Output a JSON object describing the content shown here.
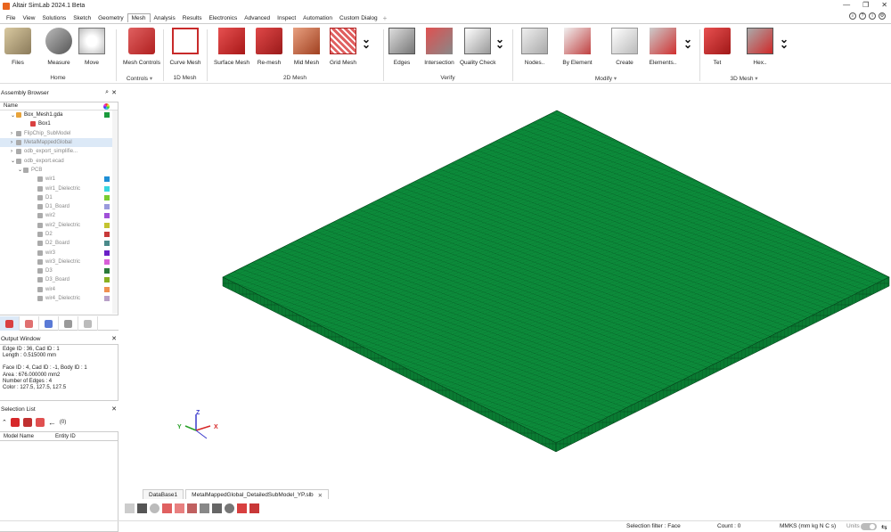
{
  "app": {
    "title": "Altair SimLab 2024.1 Beta"
  },
  "window_controls": {
    "minimize": "—",
    "restore": "❐",
    "close": "✕"
  },
  "menu": [
    "File",
    "View",
    "Solutions",
    "Sketch",
    "Geometry",
    "Mesh",
    "Analysis",
    "Results",
    "Electronics",
    "Advanced",
    "Inspect",
    "Automation",
    "Custom Dialog"
  ],
  "menu_active": "Mesh",
  "menu_right_icons": [
    "search-icon",
    "help-icon",
    "info-icon",
    "settings-icon"
  ],
  "ribbon": {
    "tools": [
      {
        "label": "Files",
        "icon": "files-icon"
      },
      {
        "label": "Measure",
        "icon": "measure-icon"
      },
      {
        "label": "Move",
        "icon": "move-icon"
      },
      {
        "label": "Mesh Controls",
        "icon": "mesh-controls-icon"
      },
      {
        "label": "Curve Mesh",
        "icon": "curve-mesh-icon"
      },
      {
        "label": "Surface Mesh",
        "icon": "surface-mesh-icon"
      },
      {
        "label": "Re-mesh",
        "icon": "remesh-icon"
      },
      {
        "label": "Mid Mesh",
        "icon": "mid-mesh-icon"
      },
      {
        "label": "Grid Mesh",
        "icon": "grid-mesh-icon"
      },
      {
        "label": "Edges",
        "icon": "edges-icon"
      },
      {
        "label": "Intersection",
        "icon": "intersection-icon"
      },
      {
        "label": "Quality Check",
        "icon": "quality-check-icon"
      },
      {
        "label": "Nodes..",
        "icon": "nodes-icon"
      },
      {
        "label": "By Element",
        "icon": "by-element-icon"
      },
      {
        "label": "Create",
        "icon": "create-icon"
      },
      {
        "label": "Elements..",
        "icon": "elements-icon"
      },
      {
        "label": "Tet",
        "icon": "tet-icon"
      },
      {
        "label": "Hex..",
        "icon": "hex-icon"
      }
    ],
    "groups": [
      "Home",
      "Controls",
      "1D Mesh",
      "2D Mesh",
      "Verify",
      "Modify",
      "3D Mesh"
    ]
  },
  "assembly_browser": {
    "title": "Assembly Browser",
    "column": "Name",
    "rows": [
      {
        "label": "Box_Mesh1.gda",
        "indent": 1,
        "arrow": "⌄",
        "color": "#1a9a3c",
        "dim": false,
        "sel": false,
        "icon": "#e8a33a"
      },
      {
        "label": "Box1",
        "indent": 3,
        "arrow": "",
        "color": "",
        "dim": false,
        "sel": false,
        "icon": "#d94040"
      },
      {
        "label": "FlipChip_SubModel",
        "indent": 1,
        "arrow": "›",
        "color": "",
        "dim": true,
        "sel": false,
        "icon": "#aaaaaa"
      },
      {
        "label": "MetalMappedGlobal",
        "indent": 1,
        "arrow": "›",
        "color": "",
        "dim": true,
        "sel": true,
        "icon": "#aaaaaa"
      },
      {
        "label": "odb_export_simplifie...",
        "indent": 1,
        "arrow": "›",
        "color": "",
        "dim": true,
        "sel": false,
        "icon": "#aaaaaa"
      },
      {
        "label": "odb_export.ecad",
        "indent": 1,
        "arrow": "⌄",
        "color": "",
        "dim": true,
        "sel": false,
        "icon": "#aaaaaa"
      },
      {
        "label": "PCB",
        "indent": 2,
        "arrow": "⌄",
        "color": "",
        "dim": true,
        "sel": false,
        "icon": "#aaaaaa"
      },
      {
        "label": "wir1",
        "indent": 4,
        "arrow": "",
        "color": "#1e8fd6",
        "dim": true,
        "sel": false,
        "icon": "#aaaaaa"
      },
      {
        "label": "wir1_Dielectric",
        "indent": 4,
        "arrow": "",
        "color": "#38d6e0",
        "dim": true,
        "sel": false,
        "icon": "#aaaaaa"
      },
      {
        "label": "D1",
        "indent": 4,
        "arrow": "",
        "color": "#7acc30",
        "dim": true,
        "sel": false,
        "icon": "#aaaaaa"
      },
      {
        "label": "D1_Board",
        "indent": 4,
        "arrow": "",
        "color": "#9a9adc",
        "dim": true,
        "sel": false,
        "icon": "#aaaaaa"
      },
      {
        "label": "wir2",
        "indent": 4,
        "arrow": "",
        "color": "#a050d8",
        "dim": true,
        "sel": false,
        "icon": "#aaaaaa"
      },
      {
        "label": "wir2_Dielectric",
        "indent": 4,
        "arrow": "",
        "color": "#c4c430",
        "dim": true,
        "sel": false,
        "icon": "#aaaaaa"
      },
      {
        "label": "D2",
        "indent": 4,
        "arrow": "",
        "color": "#c83a3a",
        "dim": true,
        "sel": false,
        "icon": "#aaaaaa"
      },
      {
        "label": "D2_Board",
        "indent": 4,
        "arrow": "",
        "color": "#4a8a8a",
        "dim": true,
        "sel": false,
        "icon": "#aaaaaa"
      },
      {
        "label": "wir3",
        "indent": 4,
        "arrow": "",
        "color": "#6a20c8",
        "dim": true,
        "sel": false,
        "icon": "#aaaaaa"
      },
      {
        "label": "wir3_Dielectric",
        "indent": 4,
        "arrow": "",
        "color": "#d860d8",
        "dim": true,
        "sel": false,
        "icon": "#aaaaaa"
      },
      {
        "label": "D3",
        "indent": 4,
        "arrow": "",
        "color": "#2a7a3a",
        "dim": true,
        "sel": false,
        "icon": "#aaaaaa"
      },
      {
        "label": "D3_Board",
        "indent": 4,
        "arrow": "",
        "color": "#8ab020",
        "dim": true,
        "sel": false,
        "icon": "#aaaaaa"
      },
      {
        "label": "wir4",
        "indent": 4,
        "arrow": "",
        "color": "#f09050",
        "dim": true,
        "sel": false,
        "icon": "#aaaaaa"
      },
      {
        "label": "wir4_Dielectric",
        "indent": 4,
        "arrow": "",
        "color": "#b8a0c8",
        "dim": true,
        "sel": false,
        "icon": "#aaaaaa"
      }
    ]
  },
  "output_window": {
    "title": "Output Window",
    "lines": [
      "Edge ID : 36, Cad ID : 1",
      "Length : 0.515000 mm",
      "",
      "Face ID : 4, Cad ID : -1, Body ID : 1",
      "Area : 676.000000 mm2",
      "Number of Edges : 4",
      "Color : 127.5, 127.5, 127.5"
    ]
  },
  "selection_list": {
    "title": "Selection List",
    "count_label": "(0)",
    "columns": [
      "Model Name",
      "Entity ID"
    ]
  },
  "doc_tabs": [
    {
      "label": "DataBase1",
      "closable": false
    },
    {
      "label": "MetalMappedGlobal_DetailedSubModel_YP.slb",
      "closable": true
    }
  ],
  "triad": {
    "x": "X",
    "y": "Y",
    "z": "Z"
  },
  "status": {
    "selection_filter": "Selection filter : Face",
    "count": "Count : 0",
    "units": "MMKS (mm kg N C s)",
    "units_label": "Units"
  },
  "colors": {
    "mesh_green": "#0c8a3a",
    "accent_red": "#d6282a"
  }
}
